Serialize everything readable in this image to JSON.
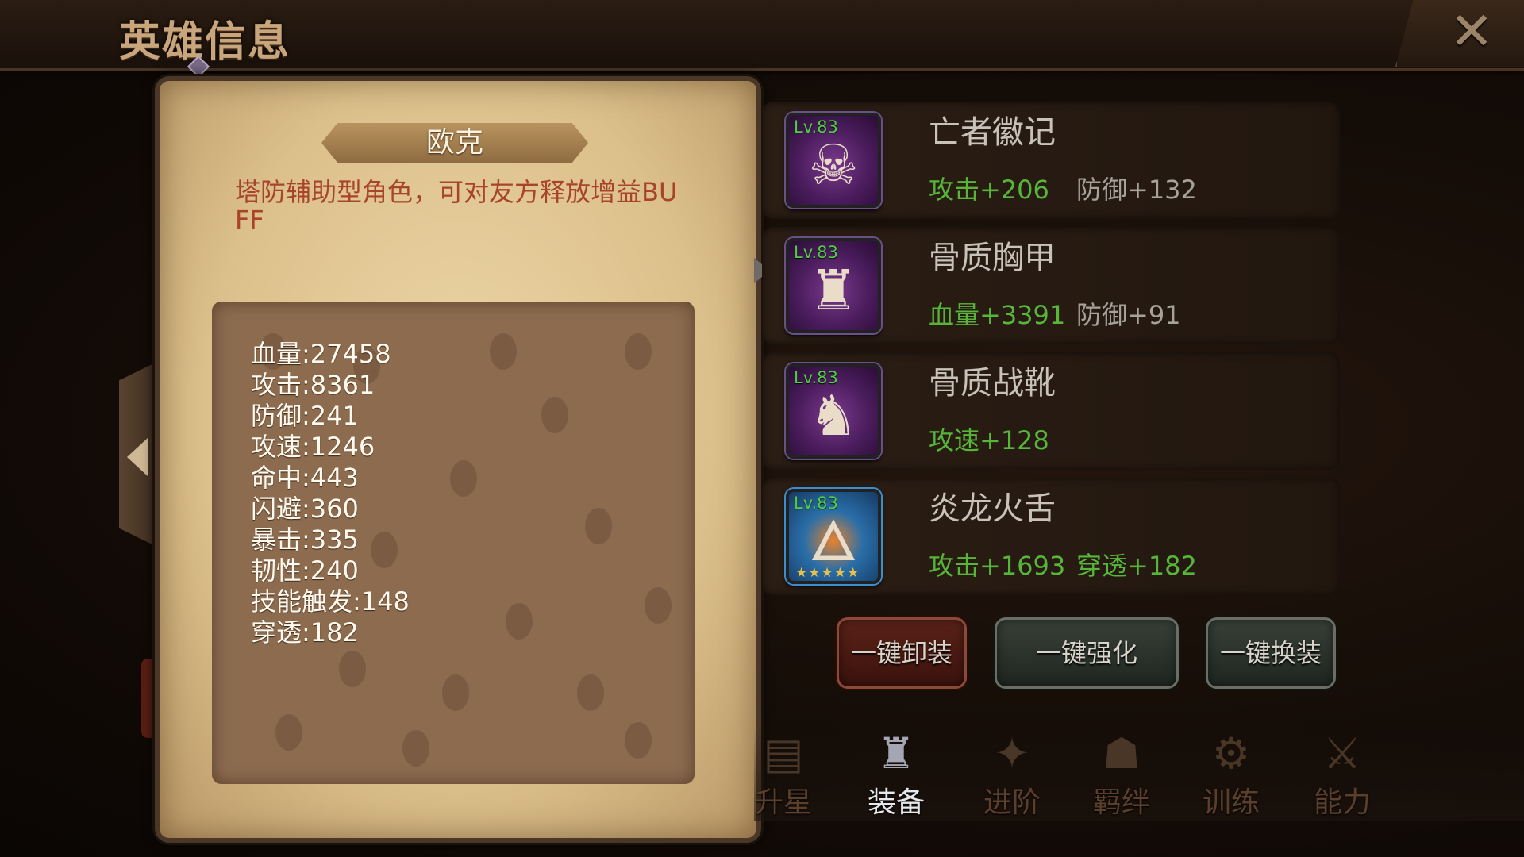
{
  "header": {
    "title": "英雄信息",
    "close_icon": "close-icon"
  },
  "hero": {
    "name": "欧克",
    "description": "塔防辅助型角色，可对友方释放增益BUFF",
    "stats": [
      "血量:27458",
      "攻击:8361",
      "防御:241",
      "攻速:1246",
      "命中:443",
      "闪避:360",
      "暴击:335",
      "韧性:240",
      "技能触发:148",
      "穿透:182"
    ]
  },
  "equipment": [
    {
      "level": "Lv.83",
      "name": "亡者徽记",
      "stat1": "攻击+206",
      "stat2": "防御+132",
      "icon": "skull-emblem-icon",
      "rarity": "purple"
    },
    {
      "level": "Lv.83",
      "name": "骨质胸甲",
      "stat1": "血量+3391",
      "stat2": "防御+91",
      "icon": "bone-armor-icon",
      "rarity": "purple"
    },
    {
      "level": "Lv.83",
      "name": "骨质战靴",
      "stat1": "攻速+128",
      "stat2": "",
      "icon": "bone-boots-icon",
      "rarity": "purple"
    },
    {
      "level": "Lv.83",
      "name": "炎龙火舌",
      "stat1": "攻击+1693",
      "stat2": "穿透+182",
      "icon": "fire-dragon-weapon-icon",
      "rarity": "blue",
      "stars": "★★★★★"
    }
  ],
  "actions": {
    "unequip_all": "一键卸装",
    "enhance_all": "一键强化",
    "swap_all": "一键换装"
  },
  "tabs": [
    {
      "label": "升星",
      "icon": "book-icon",
      "active": false
    },
    {
      "label": "装备",
      "icon": "armor-icon",
      "active": true
    },
    {
      "label": "进阶",
      "icon": "advance-icon",
      "active": false
    },
    {
      "label": "羁绊",
      "icon": "bond-icon",
      "active": false
    },
    {
      "label": "训练",
      "icon": "training-icon",
      "active": false
    },
    {
      "label": "能力",
      "icon": "ability-icon",
      "active": false
    }
  ],
  "colors": {
    "parchment": "#e3c998",
    "stat_green": "#57b63a",
    "description_red": "#a8432c",
    "level_green": "#4fd044"
  }
}
